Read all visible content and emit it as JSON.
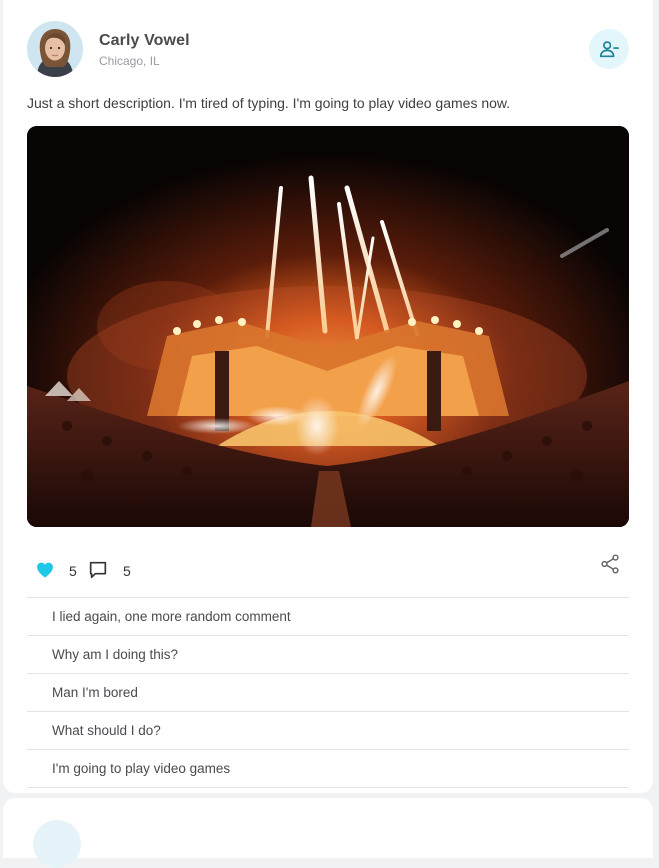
{
  "post": {
    "author": {
      "name": "Carly Vowel",
      "location": "Chicago, IL"
    },
    "description": "Just a short description. I'm tired of typing. I'm going to play video games now.",
    "likes": "5",
    "comments_count": "5",
    "comments": [
      "I lied again, one more random comment",
      "Why am I doing this?",
      "Man I'm bored",
      "What should I do?",
      "I'm going to play video games"
    ]
  },
  "colors": {
    "accent": "#1ec8e6",
    "follow_bg": "#e3f6fb",
    "follow_icon": "#1a7f97",
    "text": "#3f3f44"
  },
  "icons": {
    "follow": "user-minus-icon",
    "like": "heart-icon",
    "comment": "comment-bubble-icon",
    "share": "share-icon"
  }
}
